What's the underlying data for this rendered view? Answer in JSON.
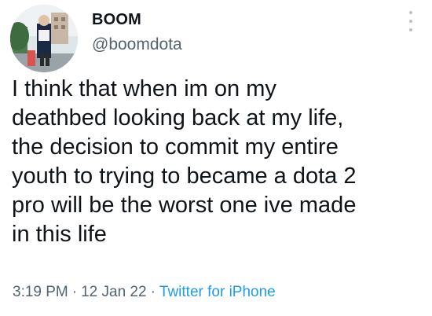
{
  "tweet": {
    "display_name": "BOOM",
    "handle": "@boomdota",
    "text": "I think that when im on my\ndeathbed looking back at my life,\nthe decision to commit my entire\nyouth to trying to became a dota 2\npro will be the worst one ive made\nin this life",
    "time": "3:19 PM",
    "separator": "·",
    "date": "12 Jan 22",
    "source": "Twitter for iPhone"
  },
  "colors": {
    "text": "#0f1419",
    "secondary": "#536471",
    "link": "#1d9bf0"
  },
  "icons": {
    "more": "more-vertical-icon",
    "avatar": "avatar-photo"
  }
}
